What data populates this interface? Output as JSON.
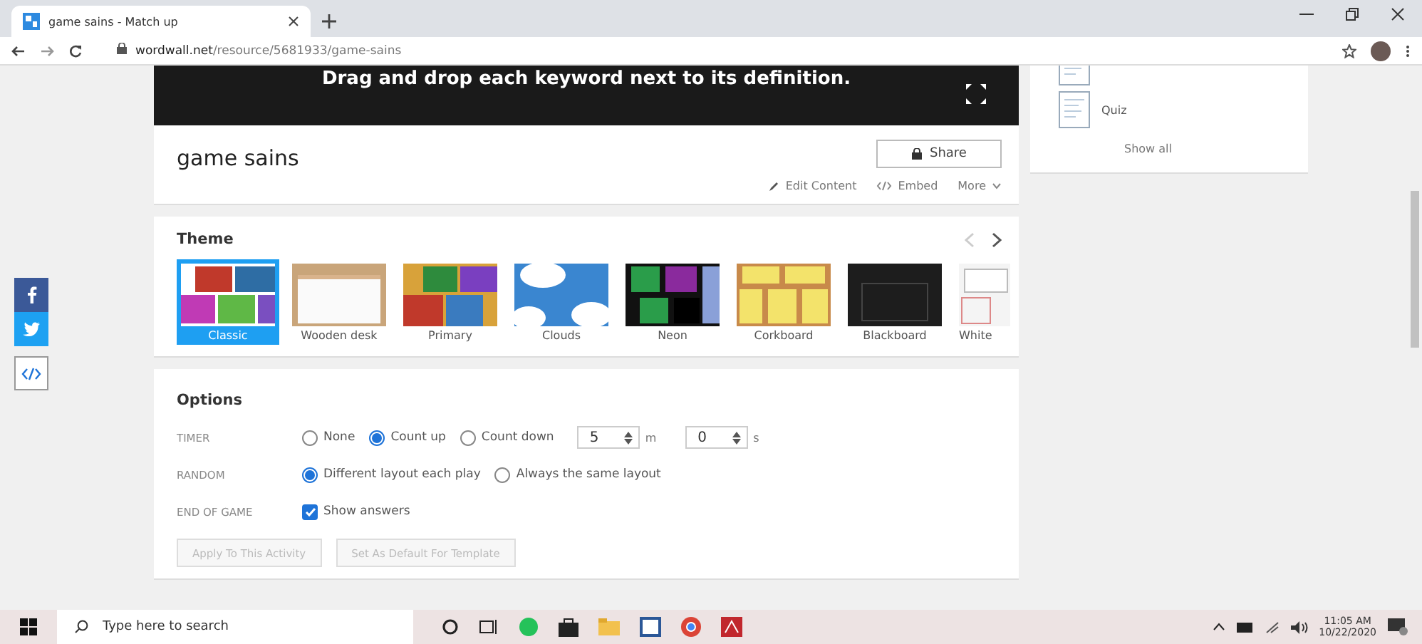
{
  "browser": {
    "tab": {
      "title": "game sains - Match up"
    },
    "url_host": "wordwall.net",
    "url_path": "/resource/5681933/game-sains"
  },
  "banner": {
    "text": "Drag and drop each keyword next to its definition."
  },
  "activity": {
    "title": "game sains",
    "share": "Share",
    "actions": [
      {
        "kind": "edit",
        "label": "Edit Content"
      },
      {
        "kind": "embed",
        "label": "Embed"
      },
      {
        "kind": "more",
        "label": "More"
      }
    ]
  },
  "sidebar": {
    "items": [
      {
        "kind": "worksheet"
      },
      {
        "kind": "quiz",
        "label": "Quiz"
      }
    ],
    "show_all": "Show all"
  },
  "theme": {
    "title": "Theme",
    "items": [
      {
        "kind": "classic",
        "label": "Classic",
        "selected": true
      },
      {
        "kind": "wooden",
        "label": "Wooden desk",
        "selected": false
      },
      {
        "kind": "primary",
        "label": "Primary",
        "selected": false
      },
      {
        "kind": "clouds",
        "label": "Clouds",
        "selected": false
      },
      {
        "kind": "neon",
        "label": "Neon",
        "selected": false
      },
      {
        "kind": "corkboard",
        "label": "Corkboard",
        "selected": false
      },
      {
        "kind": "blackboard",
        "label": "Blackboard",
        "selected": false
      },
      {
        "kind": "whiteboard",
        "label": "White",
        "selected": false
      }
    ]
  },
  "options": {
    "title": "Options",
    "timer": {
      "label": "TIMER",
      "choices": [
        {
          "label": "None",
          "selected": false
        },
        {
          "label": "Count up",
          "selected": true
        },
        {
          "label": "Count down",
          "selected": false
        }
      ],
      "minutes": "5",
      "minutes_unit": "m",
      "seconds": "0",
      "seconds_unit": "s"
    },
    "random": {
      "label": "RANDOM",
      "choices": [
        {
          "label": "Different layout each play",
          "selected": true
        },
        {
          "label": "Always the same layout",
          "selected": false
        }
      ]
    },
    "end_of_game": {
      "label": "END OF GAME",
      "option": "Show answers",
      "checked": true
    },
    "buttons": [
      {
        "label": "Apply To This Activity",
        "disabled": true
      },
      {
        "label": "Set As Default For Template",
        "disabled": true
      }
    ]
  },
  "taskbar": {
    "search_placeholder": "Type here to search",
    "time": "11:05 AM",
    "date": "10/22/2020"
  }
}
